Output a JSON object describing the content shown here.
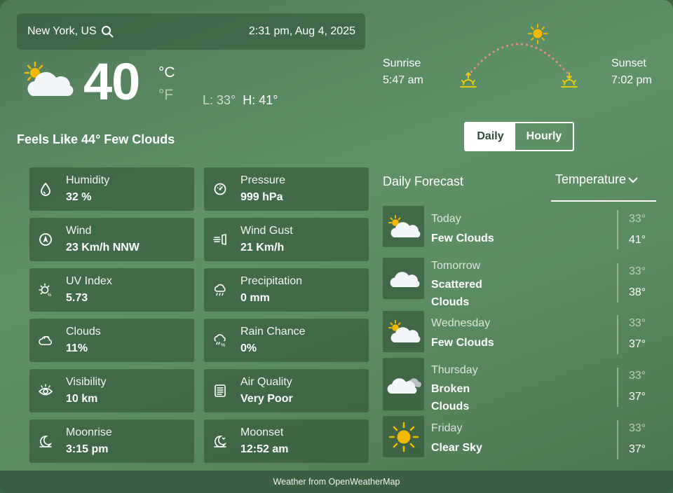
{
  "location": {
    "name": "New York, US",
    "datetime": "2:31 pm, Aug 4, 2025",
    "search_icon": "search-icon"
  },
  "current": {
    "temp": "40",
    "unit_c": "°C",
    "unit_f": "°F",
    "low": "L: 33°",
    "high": "H: 41°",
    "feels_like": "Feels Like 44° Few Clouds",
    "icon": "sun-cloud-icon"
  },
  "sun": {
    "sunrise_label": "Sunrise",
    "sunrise_time": "5:47 am",
    "sunset_label": "Sunset",
    "sunset_time": "7:02 pm",
    "arc_color": "#f08a8a",
    "sun_color": "#f5b800"
  },
  "toggle": {
    "daily": "Daily",
    "hourly": "Hourly",
    "selected": "Daily"
  },
  "tiles": [
    {
      "label": "Humidity",
      "value": "32 %",
      "icon": "droplet-icon"
    },
    {
      "label": "Pressure",
      "value": "999 hPa",
      "icon": "gauge-icon"
    },
    {
      "label": "Wind",
      "value": "23 Km/h NNW",
      "icon": "compass-icon"
    },
    {
      "label": "Wind Gust",
      "value": "21 Km/h",
      "icon": "wind-gust-icon"
    },
    {
      "label": "UV Index",
      "value": "5.73",
      "icon": "uv-icon"
    },
    {
      "label": "Precipitation",
      "value": "0 mm",
      "icon": "rain-cloud-icon"
    },
    {
      "label": "Clouds",
      "value": "11%",
      "icon": "cloud-icon"
    },
    {
      "label": "Rain Chance",
      "value": "0%",
      "icon": "rain-chance-icon"
    },
    {
      "label": "Visibility",
      "value": "10 km",
      "icon": "eye-icon"
    },
    {
      "label": "Air Quality",
      "value": "Very Poor",
      "icon": "air-quality-icon"
    },
    {
      "label": "Moonrise",
      "value": "3:15 pm",
      "icon": "moonrise-icon"
    },
    {
      "label": "Moonset",
      "value": "12:52 am",
      "icon": "moonset-icon"
    }
  ],
  "forecast": {
    "title": "Daily Forecast",
    "metric": "Temperature",
    "days": [
      {
        "day": "Today",
        "desc": "Few Clouds",
        "low": "33°",
        "high": "41°",
        "icon": "sun-cloud-icon"
      },
      {
        "day": "Tomorrow",
        "desc": "Scattered Clouds",
        "low": "33°",
        "high": "38°",
        "icon": "cloud-icon"
      },
      {
        "day": "Wednesday",
        "desc": "Few Clouds",
        "low": "33°",
        "high": "37°",
        "icon": "sun-cloud-icon"
      },
      {
        "day": "Thursday",
        "desc": "Broken Clouds",
        "low": "33°",
        "high": "37°",
        "icon": "broken-clouds-icon"
      },
      {
        "day": "Friday",
        "desc": "Clear Sky",
        "low": "33°",
        "high": "37°",
        "icon": "sun-icon"
      }
    ]
  },
  "footer": "Weather from OpenWeatherMap"
}
